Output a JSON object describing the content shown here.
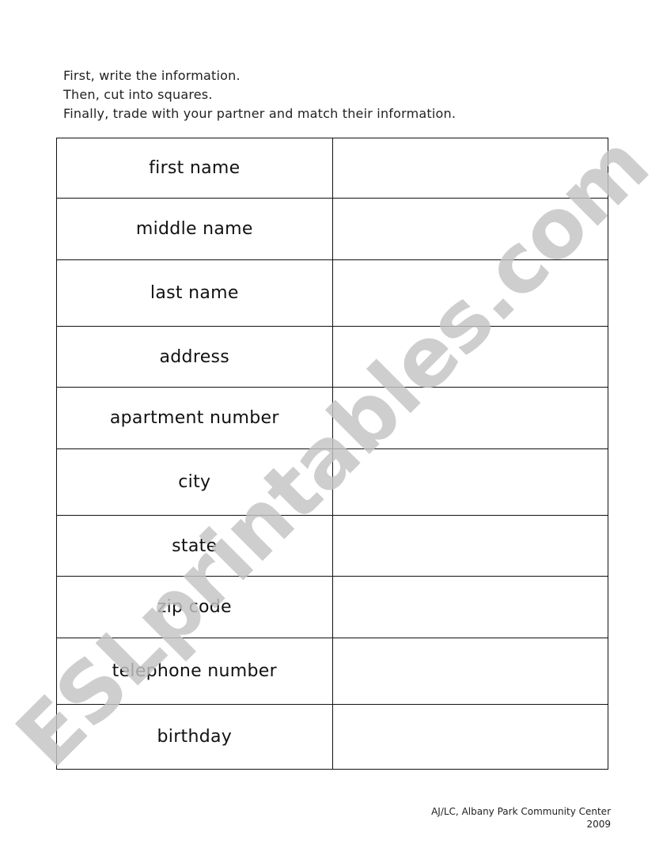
{
  "instructions": [
    "First, write the information.",
    "Then, cut into squares.",
    "Finally, trade with your partner and match their information."
  ],
  "rows": [
    {
      "label": "first name",
      "value": ""
    },
    {
      "label": "middle name",
      "value": ""
    },
    {
      "label": "last name",
      "value": ""
    },
    {
      "label": "address",
      "value": ""
    },
    {
      "label": "apartment number",
      "value": ""
    },
    {
      "label": "city",
      "value": ""
    },
    {
      "label": "state",
      "value": ""
    },
    {
      "label": "zip code",
      "value": ""
    },
    {
      "label": "telephone number",
      "value": ""
    },
    {
      "label": "birthday",
      "value": ""
    }
  ],
  "watermark": "ESLprintables.com",
  "footer": {
    "credit": "AJ/LC, Albany Park Community Center",
    "year": "2009"
  }
}
